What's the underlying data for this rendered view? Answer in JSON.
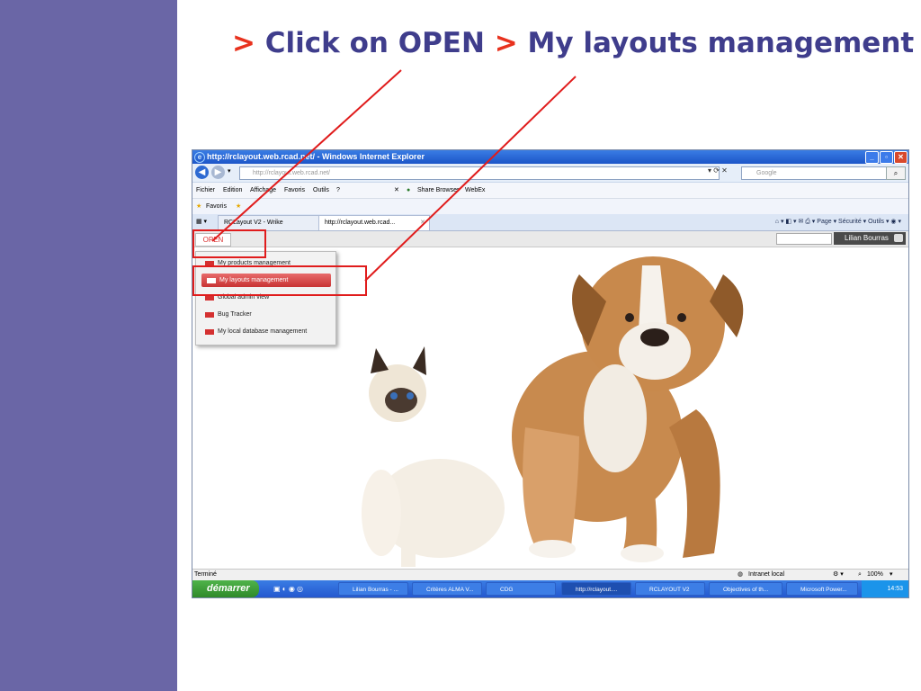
{
  "slide": {
    "title_prefix": ">",
    "title_part1": "Click on OPEN",
    "title_sep": ">",
    "title_part2": "My layouts management"
  },
  "browser": {
    "window_title": "http://rclayout.web.rcad.net/ - Windows Internet Explorer",
    "address": "http://rclayout.web.rcad.net/",
    "search_placeholder": "Google",
    "menu": [
      "Fichier",
      "Edition",
      "Affichage",
      "Favoris",
      "Outils",
      "?"
    ],
    "share_browser": "Share Browser",
    "webex": "WebEx",
    "favorites_label": "Favoris",
    "tabs": [
      "RCLayout V2 - Wrike",
      "http://rclayout.web.rcad..."
    ],
    "command_bar": "Page ▾   Sécurité ▾   Outils ▾",
    "status_left": "Terminé",
    "status_zone": "Intranet local",
    "status_zoom": "100%"
  },
  "app": {
    "open_label": "OPEN",
    "user_label": "Lilian Bourras",
    "dropdown_items": [
      "My products management",
      "My layouts management",
      "Global admin view",
      "Bug Tracker",
      "My local database management"
    ]
  },
  "taskbar": {
    "start": "démarrer",
    "tasks": [
      "Lilian Bourras - ...",
      "Critères ALMA V...",
      "CDG",
      "http://rclayout....",
      "RCLAYOUT V2",
      "Objectives of th...",
      "Microsoft Power..."
    ],
    "clock": "14:53"
  },
  "colors": {
    "sidebar": "#6a66a6",
    "title": "#3f3d8c",
    "accent_red": "#e8321e",
    "callout": "#e01c1c"
  }
}
